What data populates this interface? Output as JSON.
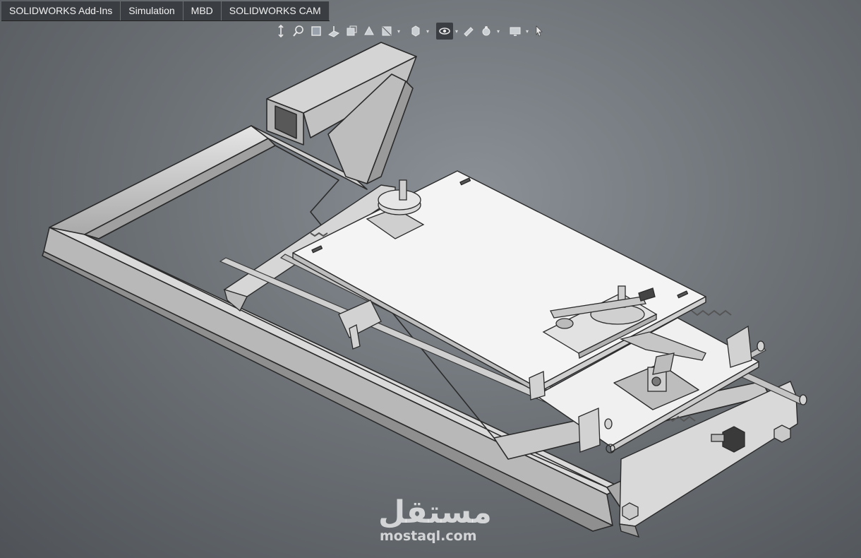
{
  "tabs": [
    {
      "label": "SOLIDWORKS Add-Ins"
    },
    {
      "label": "Simulation"
    },
    {
      "label": "MBD"
    },
    {
      "label": "SOLIDWORKS CAM"
    }
  ],
  "heads_up_toolbar": {
    "icons": [
      "zoom-to-fit-icon",
      "zoom-to-area-icon",
      "previous-view-icon",
      "section-view-icon",
      "dynamic-annotation-icon",
      "view-orientation-icon",
      "display-style-icon",
      "hide-show-items-icon",
      "edit-appearance-icon",
      "apply-scene-icon",
      "view-settings-icon",
      "select-pointer-icon"
    ]
  },
  "watermark": {
    "arabic": "مستقل",
    "site": "mostaql.com"
  },
  "colors": {
    "tab_bar": "#3a3d41",
    "part_gray": "#c9c9c9",
    "plate_white": "#f3f3f3",
    "background": "#6e7378"
  }
}
